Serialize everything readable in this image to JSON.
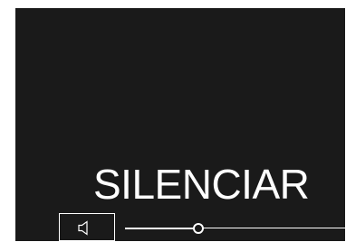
{
  "screen": {
    "title": "SILENCIAR"
  },
  "controls": {
    "mute_icon": "speaker-icon",
    "volume": {
      "value": 0.33
    }
  },
  "colors": {
    "background": "#1a1a1a",
    "foreground": "#ffffff"
  }
}
